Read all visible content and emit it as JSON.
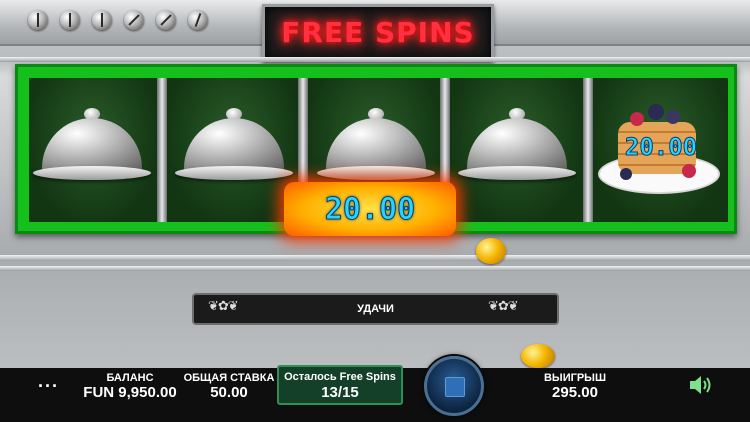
{
  "header": {
    "title": "FREE SPINS",
    "knobs": [
      "knob-1",
      "knob-2",
      "knob-3",
      "knob-4",
      "knob-5",
      "knob-6"
    ]
  },
  "reels": {
    "symbols": [
      "cloche",
      "cloche",
      "cloche",
      "cloche",
      "pancakes"
    ],
    "reel5_value": "20.00"
  },
  "win": {
    "amount": "20.00"
  },
  "message": {
    "text": "УДАЧИ"
  },
  "bottom_bar": {
    "menu_icon": "more-dots-icon",
    "balance_label": "БАЛАНС",
    "balance_value": "FUN 9,950.00",
    "bet_label": "ОБЩАЯ СТАВКА",
    "bet_value": "50.00",
    "free_spins_label": "Осталось Free Spins",
    "free_spins_value": "13/15",
    "win_label": "ВЫИГРЫШ",
    "win_value": "295.00",
    "sound_icon": "speaker-icon"
  },
  "colors": {
    "reel_frame": "#16c01c",
    "title": "#ff3040",
    "win_text": "#24d6ff"
  }
}
